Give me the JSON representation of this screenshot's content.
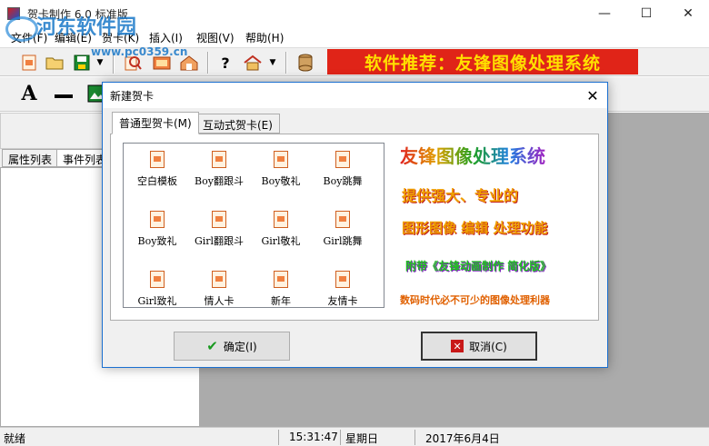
{
  "app": {
    "title": "贺卡制作 6.0 标准版",
    "watermark": "河东软件园",
    "watermark_url": "www.pc0359.cn"
  },
  "window_controls": {
    "minimize": "—",
    "maximize": "☐",
    "close": "✕"
  },
  "menu": [
    {
      "label": "文件(F)"
    },
    {
      "label": "编辑(E)"
    },
    {
      "label": "贺卡(K)"
    },
    {
      "label": "插入(I)"
    },
    {
      "label": "视图(V)"
    },
    {
      "label": "帮助(H)"
    }
  ],
  "toolbar1": {
    "icons": [
      "new-card-icon",
      "open-folder-icon",
      "save-icon",
      "dropdown-arrow-icon",
      "search-icon",
      "card-icon",
      "home-card-icon",
      "help-icon",
      "home-icon",
      "dropdown-arrow-icon",
      "database-icon"
    ],
    "banner": "软件推荐：友锋图像处理系统",
    "banner_color": "#e02418"
  },
  "toolbar2": {
    "text_tool": "A",
    "line_tool": "▬"
  },
  "left_tabs": [
    {
      "label": "属性列表"
    },
    {
      "label": "事件列表"
    }
  ],
  "status": {
    "ready": "就绪",
    "time": "15:31:47",
    "weekday": "星期日",
    "date": "2017年6月4日"
  },
  "dialog": {
    "title": "新建贺卡",
    "tabs": [
      {
        "label": "普通型贺卡(M)",
        "active": true
      },
      {
        "label": "互动式贺卡(E)",
        "active": false
      }
    ],
    "cards": [
      {
        "label": "空白模板"
      },
      {
        "label": "Boy翻跟斗"
      },
      {
        "label": "Boy敬礼"
      },
      {
        "label": "Boy跳舞"
      },
      {
        "label": "Boy致礼"
      },
      {
        "label": "Girl翻跟斗"
      },
      {
        "label": "Girl敬礼"
      },
      {
        "label": "Girl跳舞"
      },
      {
        "label": "Girl致礼"
      },
      {
        "label": "情人卡"
      },
      {
        "label": "新年"
      },
      {
        "label": "友情卡"
      }
    ],
    "preview": {
      "line1": "友锋图像处理系统",
      "line2": "提供强大、专业的",
      "line3": "图形图像 编辑 处理功能",
      "line4": "附带《友锋动画制作 简化版》",
      "line5": "数码时代必不可少的图像处理利器"
    },
    "ok_label": "确定(I)",
    "cancel_label": "取消(C)"
  }
}
